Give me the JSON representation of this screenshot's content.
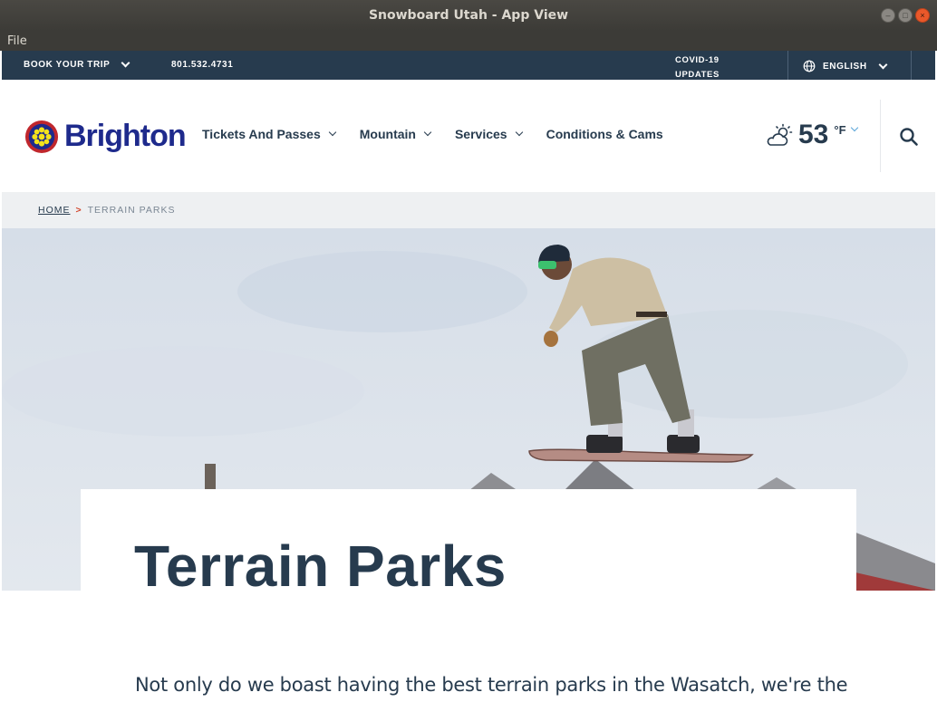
{
  "window": {
    "title": "Snowboard Utah - App View",
    "menu": [
      "File"
    ]
  },
  "utility_bar": {
    "book_label": "BOOK YOUR TRIP",
    "phone": "801.532.4731",
    "covid_line1": "COVID-19",
    "covid_line2": "UPDATES",
    "language": "ENGLISH"
  },
  "header": {
    "logo_text": "Brighton",
    "nav": [
      {
        "label": "Tickets And Passes",
        "has_dropdown": true
      },
      {
        "label": "Mountain",
        "has_dropdown": true
      },
      {
        "label": "Services",
        "has_dropdown": true
      },
      {
        "label": "Conditions & Cams",
        "has_dropdown": false
      }
    ],
    "weather": {
      "temperature": "53",
      "unit": "°F",
      "icon": "partly-cloudy-sun-icon"
    }
  },
  "breadcrumb": {
    "home": "HOME",
    "separator": ">",
    "current": "TERRAIN PARKS"
  },
  "content": {
    "title": "Terrain Parks",
    "intro": "Not only do we boast having the best terrain parks in the Wasatch, we're the"
  },
  "colors": {
    "navy": "#273b4e",
    "brand_blue": "#1e2a8c",
    "accent_red": "#d2452b",
    "weather_chevron": "#5aa4d8"
  }
}
